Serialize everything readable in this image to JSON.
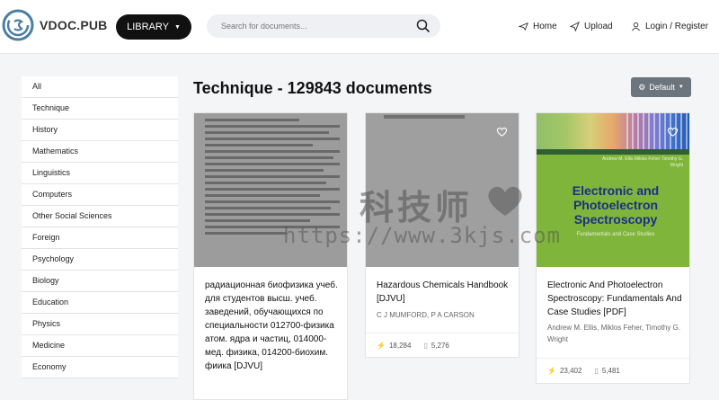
{
  "header": {
    "brand": "VDOC.PUB",
    "library_label": "LIBRARY",
    "search_placeholder": "Search for documents...",
    "nav": {
      "home": "Home",
      "upload": "Upload",
      "login": "Login / Register"
    }
  },
  "sidebar": {
    "items": [
      "All",
      "Technique",
      "History",
      "Mathematics",
      "Linguistics",
      "Computers",
      "Other Social Sciences",
      "Foreign",
      "Psychology",
      "Biology",
      "Education",
      "Physics",
      "Medicine",
      "Economy"
    ]
  },
  "main": {
    "heading": "Technique - 129843 documents",
    "sort_label": "Default",
    "cards": [
      {
        "title": "радиационная биофизика учеб. для студентов высш. учеб. заведений, обучающихся по специальности 012700-физика атом. ядра и частиц, 014000-мед. физика, 014200-биохим. фиика [DJVU]",
        "authors": "",
        "views": "",
        "downloads": ""
      },
      {
        "title": "Hazardous Chemicals Handbook [DJVU]",
        "authors": "C J MUMFORD, P A CARSON",
        "views": "18,284",
        "downloads": "5,276"
      },
      {
        "title": "Electronic And Photoelectron Spectroscopy: Fundamentals And Case Studies [PDF]",
        "authors": "Andrew M. Ellis, Miklos Feher, Timothy G. Wright",
        "views": "23,402",
        "downloads": "5,481",
        "cover": {
          "title": "Electronic and Photoelectron Spectroscopy",
          "subtitle": "Fundamentals and Case Studies",
          "authors": "Andrew M. Ellis Miklos Feher Timothy G. Wright"
        }
      }
    ]
  },
  "watermark": {
    "cn": "科技师",
    "url": "https://www.3kjs.com"
  },
  "colors": {
    "accent_dark": "#111111",
    "sort_button": "#6c757d",
    "cover_green": "#7fb53a",
    "cover_title": "#1a2f8a"
  }
}
